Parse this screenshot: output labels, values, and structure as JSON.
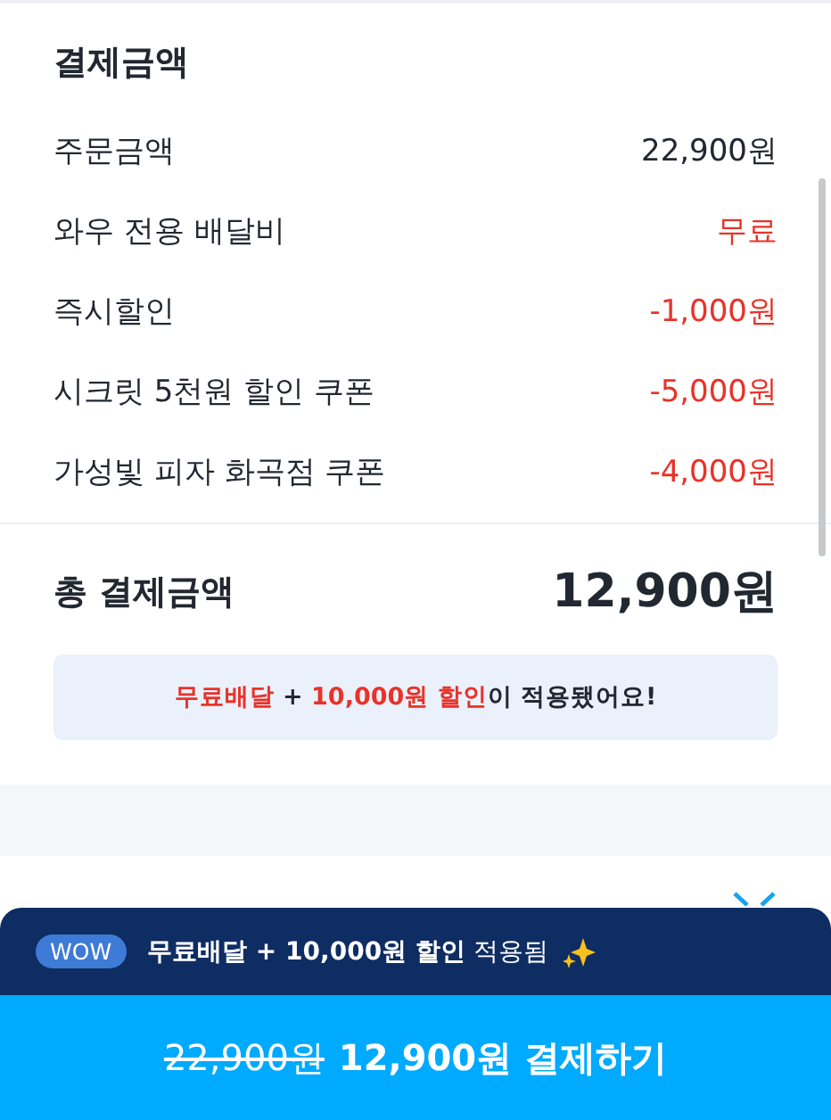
{
  "summary": {
    "title": "결제금액",
    "rows": [
      {
        "label": "주문금액",
        "value": "22,900원",
        "kind": "plain"
      },
      {
        "label": "와우 전용 배달비",
        "value": "무료",
        "kind": "benefit"
      },
      {
        "label": "즉시할인",
        "value": "-1,000원",
        "kind": "benefit"
      },
      {
        "label": "시크릿 5천원 할인 쿠폰",
        "value": "-5,000원",
        "kind": "benefit"
      },
      {
        "label": "가성빛 피자 화곡점 쿠폰",
        "value": "-4,000원",
        "kind": "benefit"
      }
    ],
    "total_label": "총 결제금액",
    "total_value": "12,900원",
    "notice": [
      {
        "text": "무료배달",
        "accent": true
      },
      {
        "text": " + ",
        "accent": false
      },
      {
        "text": "10,000원 할인",
        "accent": true
      },
      {
        "text": "이 적용됐어요!",
        "accent": false
      }
    ]
  },
  "bottom_sheet": {
    "badge": "WOW",
    "message": "**무료배달 + 10,000원 할인** 적용됨",
    "original_price": "22,900원",
    "pay_button": "12,900원 결제하기"
  }
}
